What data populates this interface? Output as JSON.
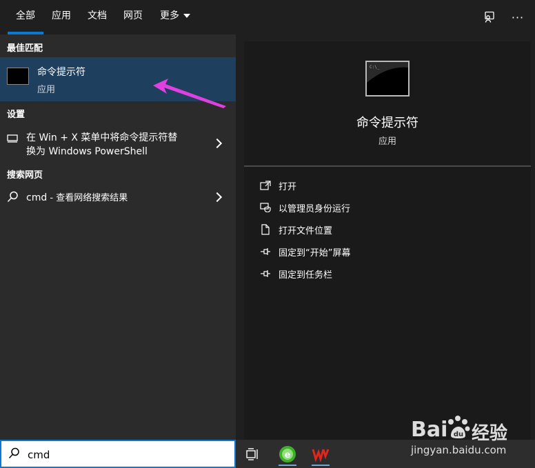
{
  "tabs": [
    {
      "label": "全部",
      "active": true
    },
    {
      "label": "应用"
    },
    {
      "label": "文档"
    },
    {
      "label": "网页"
    },
    {
      "label": "更多"
    }
  ],
  "sections": {
    "best_match": "最佳匹配",
    "settings": "设置",
    "web": "搜索网页"
  },
  "best_match": {
    "title": "命令提示符",
    "subtitle": "应用"
  },
  "settings_item": {
    "line1": "在 Win + X 菜单中将命令提示符替",
    "line2": "换为 Windows PowerShell"
  },
  "web_item": {
    "query": "cmd",
    "suffix": " - 查看网络搜索结果"
  },
  "preview": {
    "title": "命令提示符",
    "subtitle": "应用"
  },
  "actions": [
    {
      "label": "打开",
      "icon": "open-icon"
    },
    {
      "label": "以管理员身份运行",
      "icon": "shield-icon"
    },
    {
      "label": "打开文件位置",
      "icon": "file-location-icon"
    },
    {
      "label": "固定到“开始”屏幕",
      "icon": "pin-icon"
    },
    {
      "label": "固定到任务栏",
      "icon": "pin-icon"
    }
  ],
  "search": {
    "value": "cmd"
  },
  "watermark": {
    "brand_left": "Bai",
    "brand_right": "经验",
    "url": "jingyan.baidu.com"
  },
  "colors": {
    "accent": "#0a78d4",
    "highlight": "#1f3f5e",
    "arrow": "#e040e0"
  }
}
